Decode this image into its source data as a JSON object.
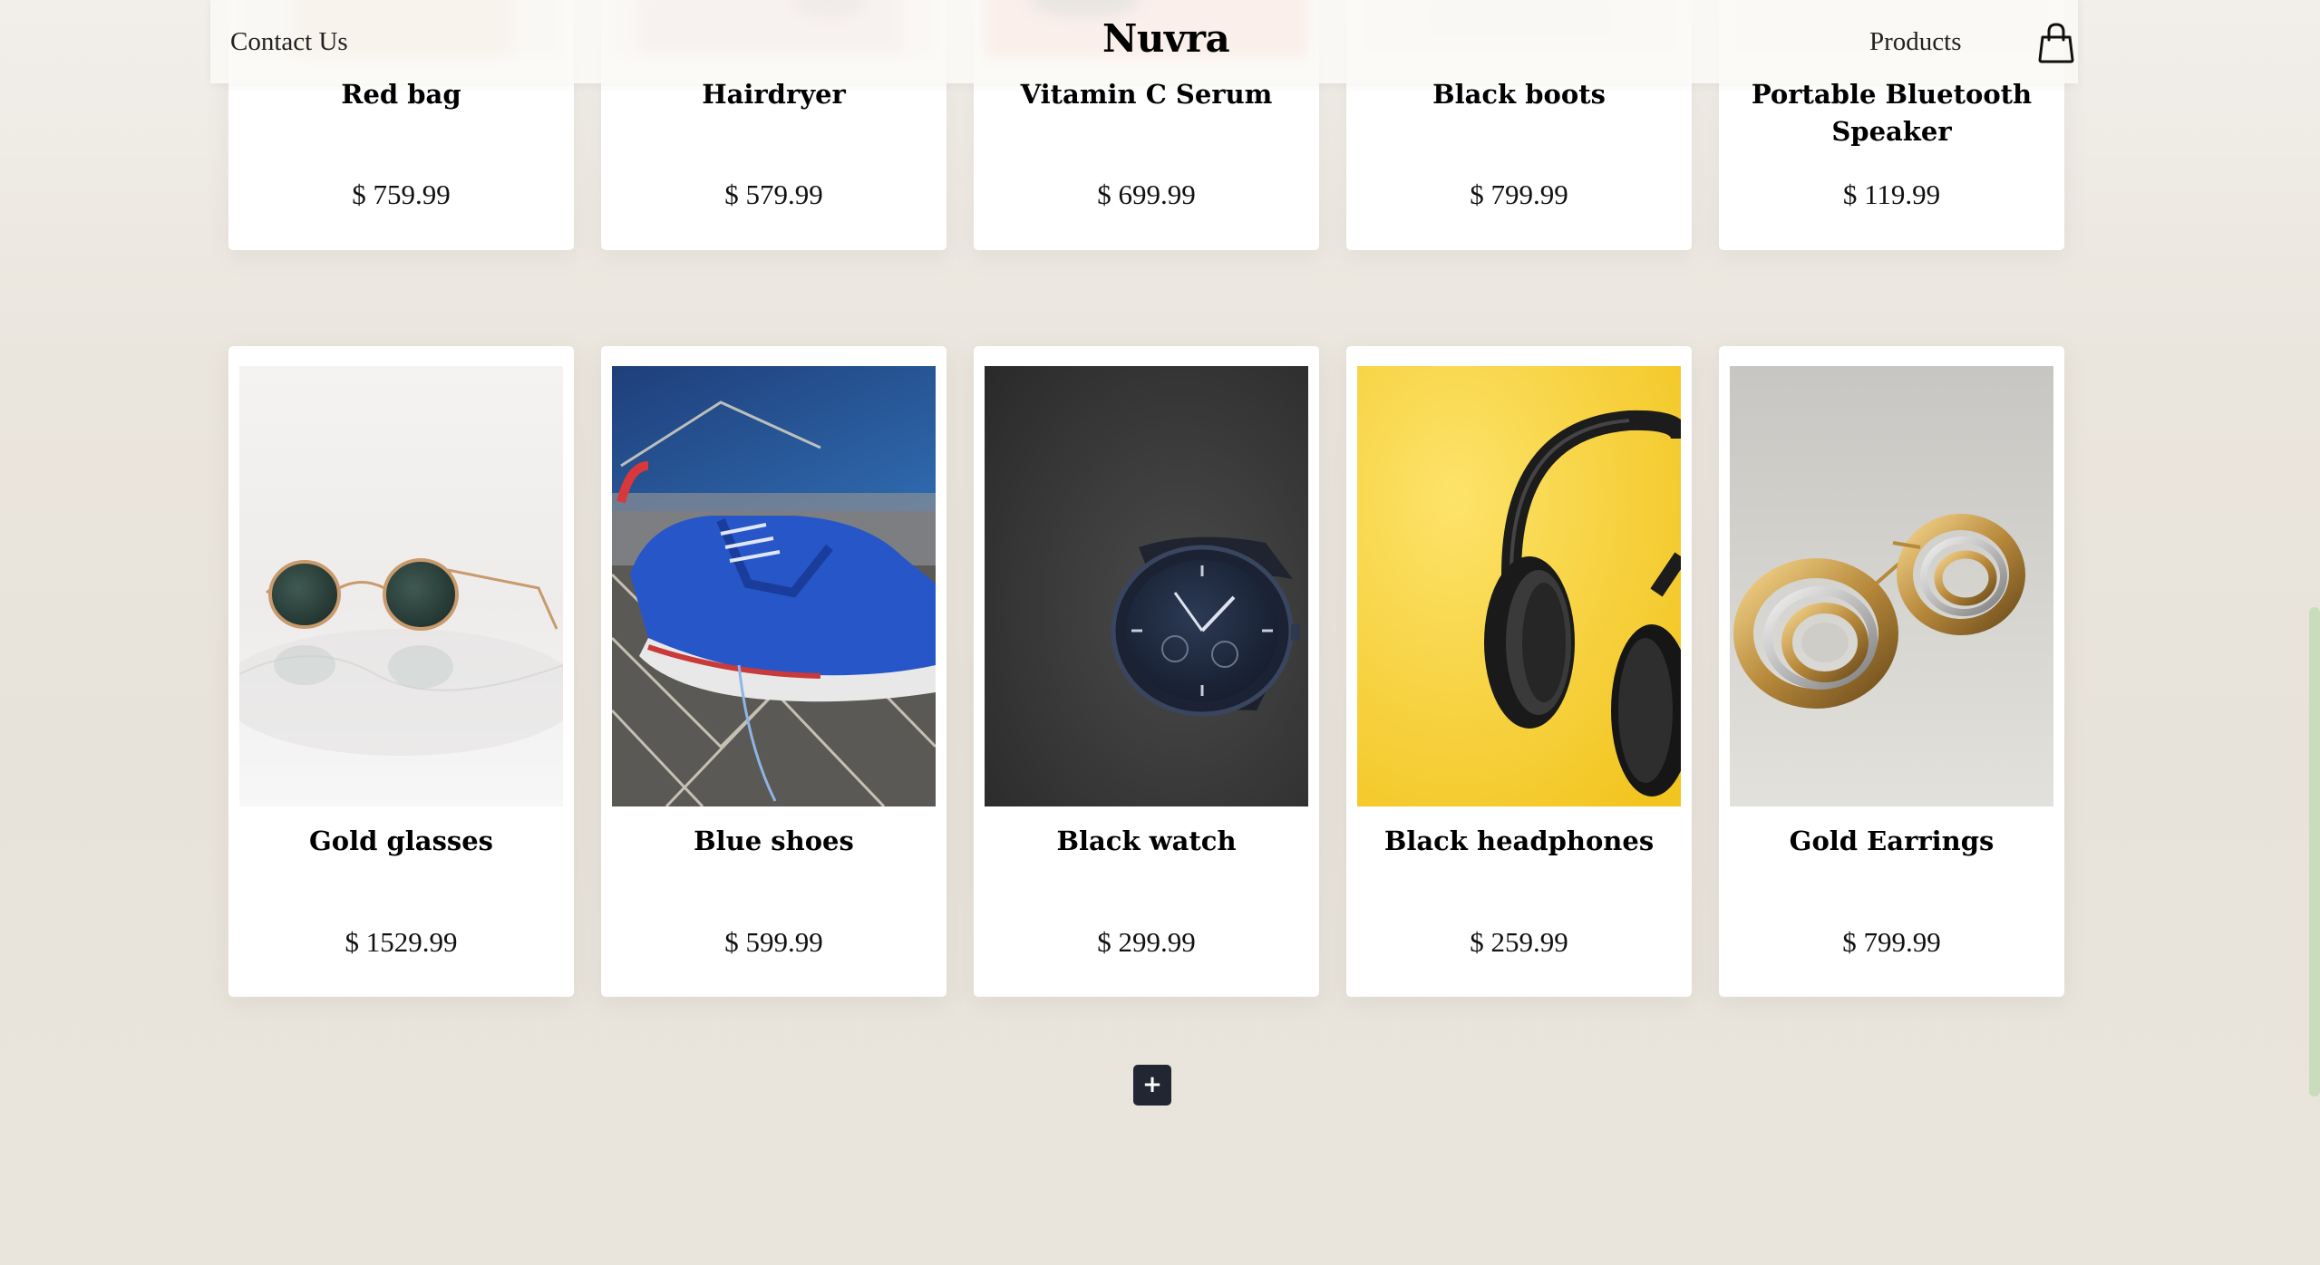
{
  "header": {
    "contact_label": "Contact Us",
    "logo": "Nuvra",
    "products_label": "Products",
    "cart_icon": "shopping-bag-icon"
  },
  "products_row_top": [
    {
      "name": "Red bag",
      "price": "$ 759.99",
      "image": "red-bag-image"
    },
    {
      "name": "Hairdryer",
      "price": "$ 579.99",
      "image": "hairdryer-image"
    },
    {
      "name": "Vitamin C Serum",
      "price": "$ 699.99",
      "image": "vitamin-c-serum-image"
    },
    {
      "name": "Black boots",
      "price": "$ 799.99",
      "image": "black-boots-image"
    },
    {
      "name": "Portable Bluetooth Speaker",
      "price": "$ 119.99",
      "image": "bluetooth-speaker-image"
    }
  ],
  "products_row_bottom": [
    {
      "name": "Gold glasses",
      "price": "$ 1529.99",
      "image": "gold-glasses-image"
    },
    {
      "name": "Blue shoes",
      "price": "$ 599.99",
      "image": "blue-shoes-image"
    },
    {
      "name": "Black watch",
      "price": "$ 299.99",
      "image": "black-watch-image"
    },
    {
      "name": "Black headphones",
      "price": "$ 259.99",
      "image": "black-headphones-image"
    },
    {
      "name": "Gold Earrings",
      "price": "$ 799.99",
      "image": "gold-earrings-image"
    }
  ],
  "load_more": {
    "label": "+",
    "icon": "plus-icon"
  },
  "colors": {
    "background": "#ebe6de",
    "card": "#ffffff",
    "button": "#222633",
    "scrollbar_thumb": "#c9dcbc"
  }
}
